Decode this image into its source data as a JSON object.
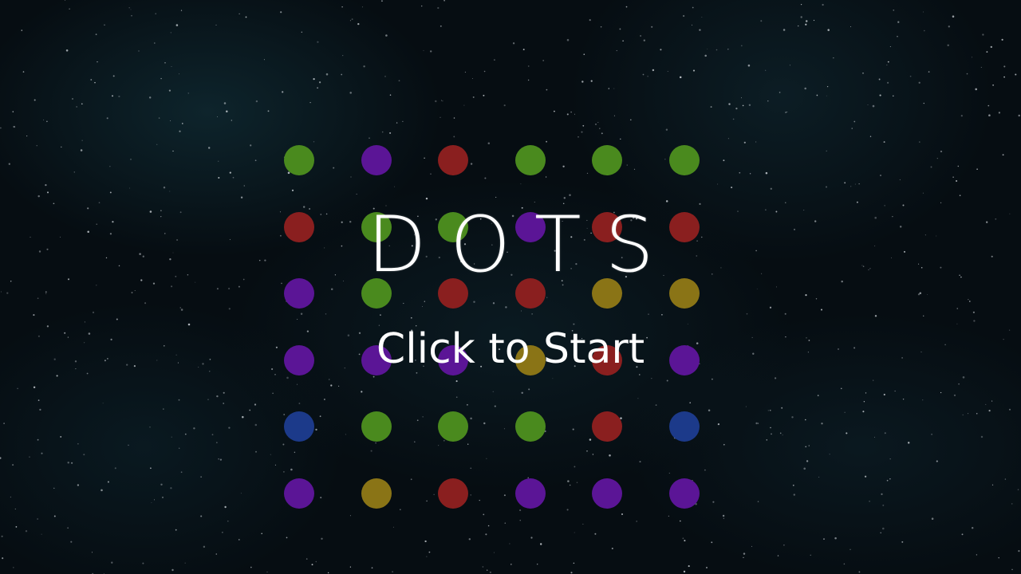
{
  "title": "DOTS",
  "prompt": "Click to Start",
  "colors": {
    "green": "#4a8a1e",
    "purple": "#5b1596",
    "red": "#8a1f1f",
    "yellow": "#8a7416",
    "blue": "#1c3a8a",
    "background": "#060d12"
  },
  "grid": {
    "rows": [
      [
        "green",
        "purple",
        "red",
        "green",
        "green",
        "green"
      ],
      [
        "red",
        "green",
        "green",
        "purple",
        "red",
        "red"
      ],
      [
        "purple",
        "green",
        "red",
        "red",
        "yellow",
        "yellow"
      ],
      [
        "purple",
        "purple",
        "purple",
        "yellow",
        "red",
        "purple"
      ],
      [
        "blue",
        "green",
        "green",
        "green",
        "red",
        "blue"
      ],
      [
        "purple",
        "yellow",
        "red",
        "purple",
        "purple",
        "purple"
      ]
    ]
  }
}
